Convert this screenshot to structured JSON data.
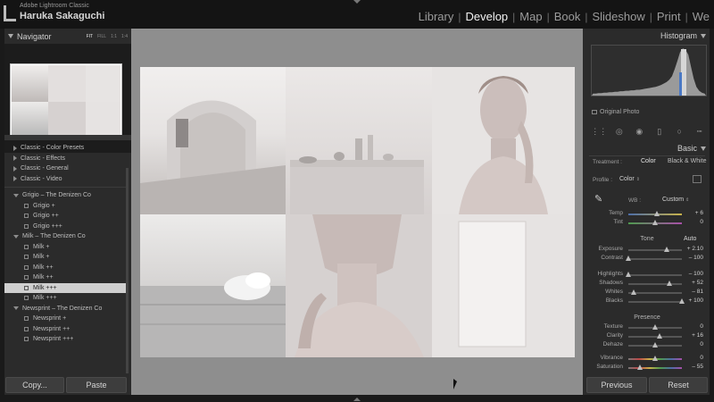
{
  "app": {
    "name": "Adobe Lightroom Classic",
    "user": "Haruka Sakaguchi"
  },
  "modules": [
    {
      "label": "Library",
      "active": false
    },
    {
      "label": "Develop",
      "active": true
    },
    {
      "label": "Map",
      "active": false
    },
    {
      "label": "Book",
      "active": false
    },
    {
      "label": "Slideshow",
      "active": false
    },
    {
      "label": "Print",
      "active": false
    },
    {
      "label": "We",
      "active": false
    }
  ],
  "navigator": {
    "title": "Navigator",
    "zoom_options": [
      "FIT",
      "FILL",
      "1:1",
      "1:4"
    ],
    "active_zoom": "FIT"
  },
  "presets": {
    "groups": [
      {
        "label": "Classic - Color Presets",
        "open": false,
        "items": []
      },
      {
        "label": "Classic - Effects",
        "open": false,
        "items": []
      },
      {
        "label": "Classic - General",
        "open": false,
        "items": []
      },
      {
        "label": "Classic - Video",
        "open": false,
        "items": []
      },
      {
        "label": "Grigio – The Denizen Co",
        "open": true,
        "items": [
          "Grigio +",
          "Grigio ++",
          "Grigio +++"
        ]
      },
      {
        "label": "Milk – The Denizen Co",
        "open": true,
        "items": [
          "Milk +",
          "Milk +",
          "Milk ++",
          "Milk ++",
          "Milk +++",
          "Milk +++"
        ]
      },
      {
        "label": "Newsprint – The Denizen Co",
        "open": true,
        "items": [
          "Newsprint +",
          "Newsprint ++",
          "Newsprint +++"
        ]
      }
    ],
    "selected": "Milk +++"
  },
  "left_buttons": {
    "copy": "Copy...",
    "paste": "Paste"
  },
  "histogram": {
    "title": "Histogram",
    "original_label": "Original Photo",
    "levels": [
      4,
      4,
      5,
      5,
      6,
      6,
      7,
      7,
      8,
      8,
      9,
      9,
      10,
      10,
      11,
      11,
      12,
      12,
      13,
      14,
      15,
      16,
      17,
      18,
      20,
      22,
      25,
      28,
      33,
      40,
      55,
      72,
      90,
      98,
      95,
      85,
      60,
      35,
      18,
      10,
      6,
      4
    ]
  },
  "basic": {
    "title": "Basic",
    "treatment_label": "Treatment :",
    "treatment_options": [
      "Color",
      "Black & White"
    ],
    "profile_label": "Profile :",
    "profile_value": "Color",
    "wb_label": "WB :",
    "wb_value": "Custom",
    "tone_label": "Tone",
    "auto_label": "Auto",
    "presence_label": "Presence",
    "sliders": [
      {
        "label": "Temp",
        "value": "+ 6",
        "pos": 0.53
      },
      {
        "label": "Tint",
        "value": "0",
        "pos": 0.5
      },
      {
        "label": "Exposure",
        "value": "+ 2.10",
        "pos": 0.71
      },
      {
        "label": "Contrast",
        "value": "– 100",
        "pos": 0.0
      },
      {
        "label": "Highlights",
        "value": "– 100",
        "pos": 0.0
      },
      {
        "label": "Shadows",
        "value": "+ 52",
        "pos": 0.76
      },
      {
        "label": "Whites",
        "value": "– 81",
        "pos": 0.1
      },
      {
        "label": "Blacks",
        "value": "+ 100",
        "pos": 1.0
      },
      {
        "label": "Texture",
        "value": "0",
        "pos": 0.5
      },
      {
        "label": "Clarity",
        "value": "+ 16",
        "pos": 0.58
      },
      {
        "label": "Dehaze",
        "value": "0",
        "pos": 0.5
      },
      {
        "label": "Vibrance",
        "value": "0",
        "pos": 0.5
      },
      {
        "label": "Saturation",
        "value": "– 55",
        "pos": 0.22
      }
    ]
  },
  "right_buttons": {
    "previous": "Previous",
    "reset": "Reset"
  }
}
